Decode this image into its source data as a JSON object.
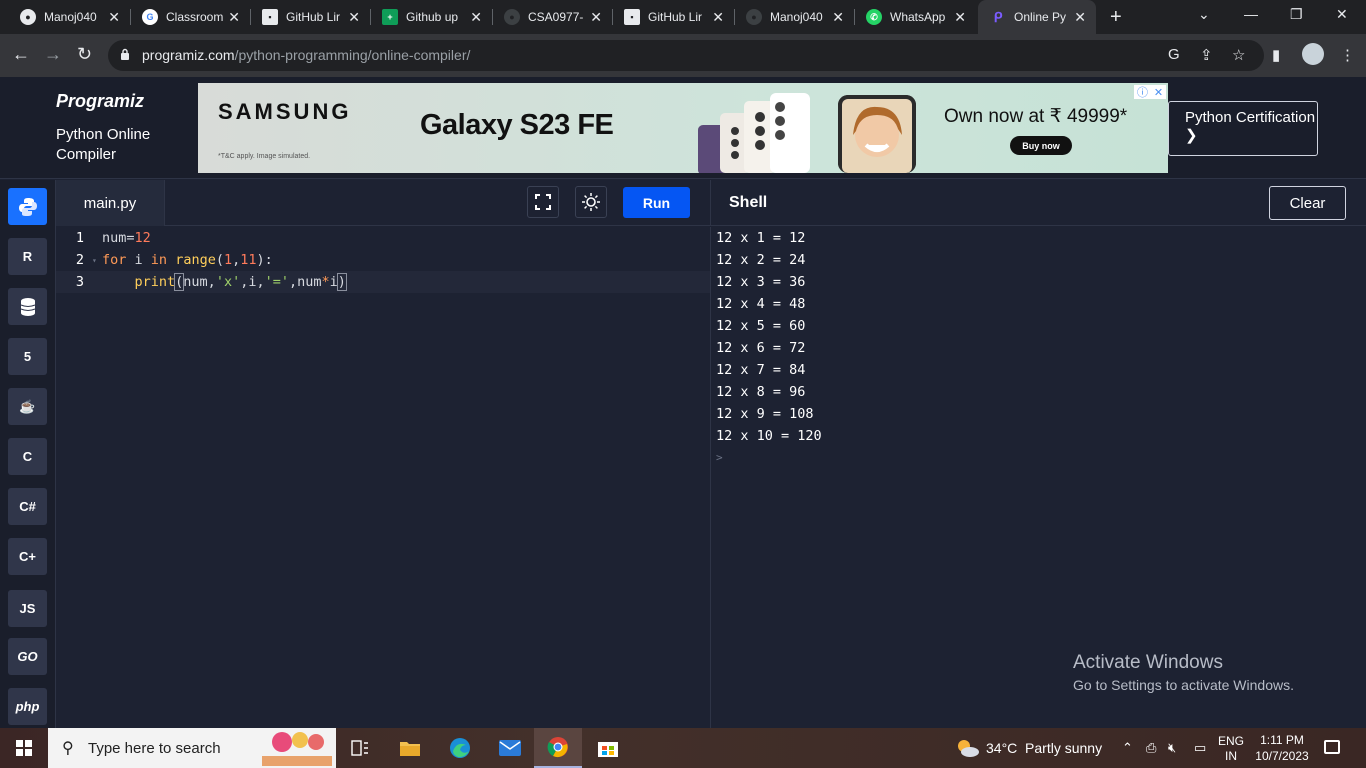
{
  "browser": {
    "tabs": [
      {
        "title": "Manoj040",
        "icon": "github-icon"
      },
      {
        "title": "Classroom",
        "icon": "google-icon"
      },
      {
        "title": "GitHub Lir",
        "icon": "page-icon"
      },
      {
        "title": "Github up",
        "icon": "sheets-icon"
      },
      {
        "title": "CSA0977-",
        "icon": "github-icon"
      },
      {
        "title": "GitHub Lir",
        "icon": "page-icon"
      },
      {
        "title": "Manoj040",
        "icon": "github-icon"
      },
      {
        "title": "WhatsApp",
        "icon": "whatsapp-icon"
      },
      {
        "title": "Online Py",
        "icon": "programiz-icon",
        "active": true
      }
    ],
    "url_domain": "programiz.com",
    "url_path": "/python-programming/online-compiler/"
  },
  "header": {
    "logo": "Programiz",
    "subtitle": "Python Online Compiler",
    "cert_button": "Python Certification ❯"
  },
  "ad": {
    "brand": "SAMSUNG",
    "model": "Galaxy S23 FE",
    "offer": "Own now at ₹ 49999*",
    "cta": "Buy now",
    "disclaimer": "*T&C apply. Image simulated."
  },
  "languages": [
    "python-icon",
    "r-icon",
    "sql-icon",
    "html5-icon",
    "java-icon",
    "c-icon",
    "csharp-icon",
    "cpp-icon",
    "JS",
    "GO",
    "php"
  ],
  "editor": {
    "filename": "main.py",
    "run_label": "Run",
    "line_numbers": [
      "1",
      "2",
      "3"
    ]
  },
  "shell": {
    "title": "Shell",
    "clear_label": "Clear",
    "output": [
      "12 x 1 = 12",
      "12 x 2 = 24",
      "12 x 3 = 36",
      "12 x 4 = 48",
      "12 x 5 = 60",
      "12 x 6 = 72",
      "12 x 7 = 84",
      "12 x 8 = 96",
      "12 x 9 = 108",
      "12 x 10 = 120"
    ],
    "prompt": ">"
  },
  "watermark": {
    "line1": "Activate Windows",
    "line2": "Go to Settings to activate Windows."
  },
  "taskbar": {
    "search_placeholder": "Type here to search",
    "weather": "34°C  Partly sunny",
    "lang_line1": "ENG",
    "lang_line2": "IN",
    "time": "1:11 PM",
    "date": "10/7/2023"
  },
  "colors": {
    "accent": "#0556f3",
    "background": "#1d2232",
    "keyword": "#ff9a57",
    "function": "#ffcf5b",
    "number": "#ff7b5b",
    "string": "#9fd16a"
  }
}
